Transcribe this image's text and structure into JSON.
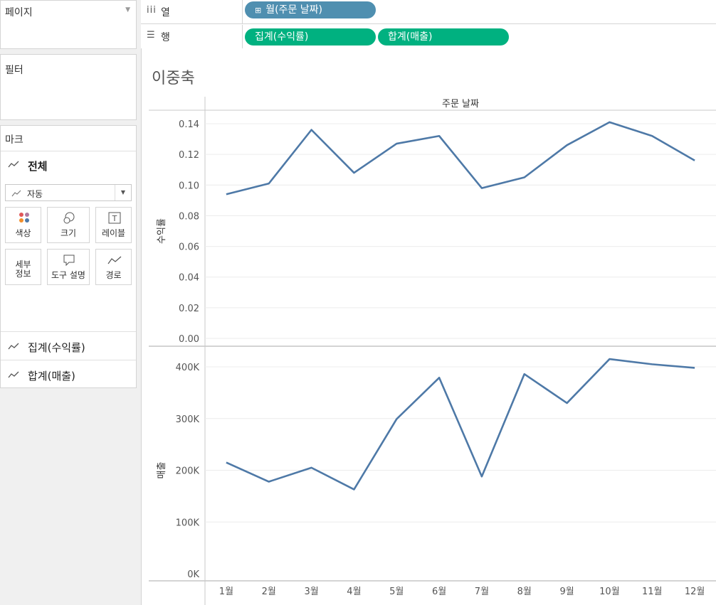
{
  "pages": {
    "title": "페이지"
  },
  "filters": {
    "title": "필터"
  },
  "marks": {
    "title": "마크",
    "all_label": "전체",
    "mark_type": "자동",
    "buttons": [
      {
        "label": "색상",
        "icon": "color-dots-icon"
      },
      {
        "label": "크기",
        "icon": "size-circles-icon"
      },
      {
        "label": "레이블",
        "icon": "label-t-icon"
      },
      {
        "label": "세부\n정보",
        "icon": "detail-icon"
      },
      {
        "label": "도구 설명",
        "icon": "tooltip-bubble-icon"
      },
      {
        "label": "경로",
        "icon": "path-line-icon"
      }
    ],
    "measure_cards": [
      "집계(수익률)",
      "합계(매출)"
    ]
  },
  "shelves": {
    "columns": {
      "label": "열",
      "pills": [
        "월(주문 날짜)"
      ]
    },
    "rows": {
      "label": "행",
      "pills": [
        "집계(수익률)",
        "합계(매출)"
      ]
    }
  },
  "sheet": {
    "title": "이중축"
  },
  "colors": {
    "line": "#4e79a7",
    "pill_blue": "#4f8fb0",
    "pill_green": "#00b180"
  },
  "chart_data": {
    "type": "line",
    "header": "주문 날짜",
    "categories": [
      "1월",
      "2월",
      "3월",
      "4월",
      "5월",
      "6월",
      "7월",
      "8월",
      "9월",
      "10월",
      "11월",
      "12월"
    ],
    "panes": [
      {
        "ylabel": "수익률",
        "ylim": [
          0,
          0.14
        ],
        "yticks": [
          0.0,
          0.02,
          0.04,
          0.06,
          0.08,
          0.1,
          0.12,
          0.14
        ],
        "ytick_labels": [
          "0.00",
          "0.02",
          "0.04",
          "0.06",
          "0.08",
          "0.10",
          "0.12",
          "0.14"
        ],
        "values": [
          0.094,
          0.101,
          0.136,
          0.108,
          0.127,
          0.132,
          0.098,
          0.105,
          0.126,
          0.141,
          0.132,
          0.116
        ]
      },
      {
        "ylabel": "매출",
        "ylim": [
          0,
          400000
        ],
        "yticks": [
          0,
          100000,
          200000,
          300000,
          400000
        ],
        "ytick_labels": [
          "0K",
          "100K",
          "200K",
          "300K",
          "400K"
        ],
        "values": [
          215000,
          178000,
          205000,
          163000,
          299000,
          379000,
          188000,
          386000,
          330000,
          415000,
          405000,
          398000
        ]
      }
    ],
    "grid": true
  }
}
